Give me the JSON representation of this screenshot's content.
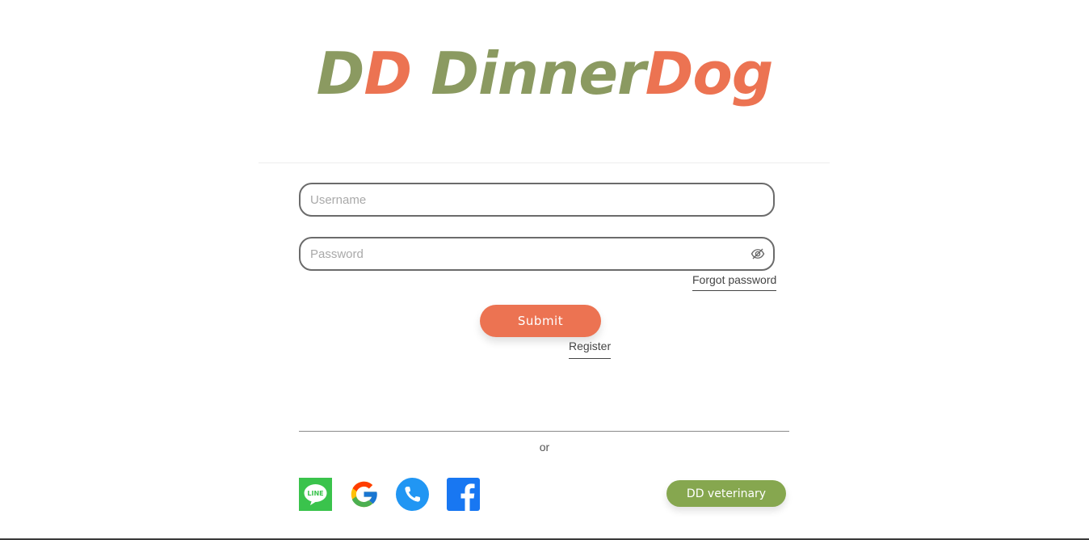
{
  "logo": {
    "part1": "D",
    "part2": "D",
    "part3": "Dinner",
    "part4": "Dog",
    "colors": {
      "green": "#8b9a61",
      "orange": "#ec7352"
    }
  },
  "form": {
    "username_placeholder": "Username",
    "username_value": "",
    "password_placeholder": "Password",
    "password_value": "",
    "toggle_icon": "eye-slash-icon",
    "forgot_label": "Forgot password",
    "submit_label": "Submit",
    "register_label": "Register"
  },
  "divider": {
    "or_label": "or"
  },
  "social": {
    "items": [
      {
        "name": "line",
        "icon": "line-icon",
        "label": "LINE",
        "color": "#3ac34c"
      },
      {
        "name": "google",
        "icon": "google-icon"
      },
      {
        "name": "phone",
        "icon": "phone-icon",
        "color": "#2196f3"
      },
      {
        "name": "facebook",
        "icon": "facebook-icon",
        "color": "#1877f2"
      }
    ],
    "vet_label": "DD veterinary"
  },
  "colors": {
    "accent": "#ec7352",
    "secondary": "#86a74f"
  }
}
